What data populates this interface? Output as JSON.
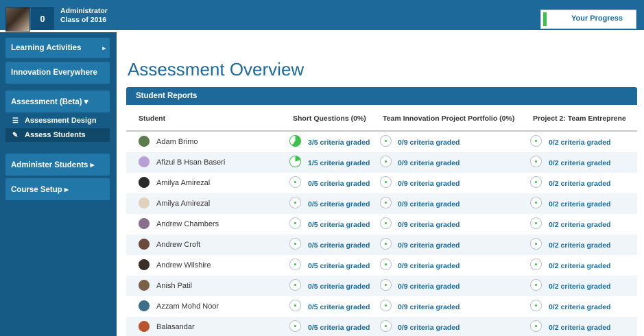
{
  "user": {
    "score": "0",
    "name": "Administrator",
    "class": "Class of 2016"
  },
  "progress": {
    "label": "Your Progress"
  },
  "sidebar": {
    "items": [
      {
        "label": "Learning Activities",
        "arrow": "▸"
      },
      {
        "label": "Innovation Everywhere"
      },
      {
        "label": "Assessment (Beta) ▾"
      },
      {
        "label": "Administer Students ▸"
      },
      {
        "label": "Course Setup ▸"
      }
    ],
    "subitems": [
      {
        "label": "Assessment Design",
        "icon": "list-icon"
      },
      {
        "label": "Assess Students",
        "icon": "chat-icon"
      }
    ]
  },
  "page": {
    "title": "Assessment Overview"
  },
  "panel": {
    "title": "Student Reports"
  },
  "table": {
    "headers": [
      "Student",
      "Short Questions (0%)",
      "Team Innovation Project Portfolio (0%)",
      "Project 2: Team Entreprene"
    ],
    "rows": [
      {
        "name": "Adam Brimo",
        "avatar_color": "#5b7a4e",
        "c1": "3/5 criteria graded",
        "c1_fraction": 0.6,
        "c2": "0/9 criteria graded",
        "c3": "0/2 criteria graded"
      },
      {
        "name": "Afizul B Hsan Baseri",
        "avatar_color": "#b8a0d6",
        "c1": "1/5 criteria graded",
        "c1_fraction": 0.2,
        "c2": "0/9 criteria graded",
        "c3": "0/2 criteria graded"
      },
      {
        "name": "Amilya Amirezal",
        "avatar_color": "#2b2b2b",
        "c1": "0/5 criteria graded",
        "c1_fraction": 0,
        "c2": "0/9 criteria graded",
        "c3": "0/2 criteria graded"
      },
      {
        "name": "Amilya Amirezal",
        "avatar_color": "#e0d2bd",
        "c1": "0/5 criteria graded",
        "c1_fraction": 0,
        "c2": "0/9 criteria graded",
        "c3": "0/2 criteria graded"
      },
      {
        "name": "Andrew Chambers",
        "avatar_color": "#8a6f8c",
        "c1": "0/5 criteria graded",
        "c1_fraction": 0,
        "c2": "0/9 criteria graded",
        "c3": "0/2 criteria graded"
      },
      {
        "name": "Andrew Croft",
        "avatar_color": "#6a4a3a",
        "c1": "0/5 criteria graded",
        "c1_fraction": 0,
        "c2": "0/9 criteria graded",
        "c3": "0/2 criteria graded"
      },
      {
        "name": "Andrew Wilshire",
        "avatar_color": "#3a2e28",
        "c1": "0/5 criteria graded",
        "c1_fraction": 0,
        "c2": "0/9 criteria graded",
        "c3": "0/2 criteria graded"
      },
      {
        "name": "Anish Patil",
        "avatar_color": "#7a6048",
        "c1": "0/5 criteria graded",
        "c1_fraction": 0,
        "c2": "0/9 criteria graded",
        "c3": "0/2 criteria graded"
      },
      {
        "name": "Azzam Mohd Noor",
        "avatar_color": "#3d6e8a",
        "c1": "0/5 criteria graded",
        "c1_fraction": 0,
        "c2": "0/9 criteria graded",
        "c3": "0/2 criteria graded"
      },
      {
        "name": "Balasandar",
        "avatar_color": "#b8552e",
        "c1": "0/5 criteria graded",
        "c1_fraction": 0,
        "c2": "0/9 criteria graded",
        "c3": "0/2 criteria graded"
      }
    ]
  },
  "colors": {
    "accent": "#1d6a9a",
    "progress_green": "#3ec14a",
    "sidebar_bg": "#155b86"
  }
}
